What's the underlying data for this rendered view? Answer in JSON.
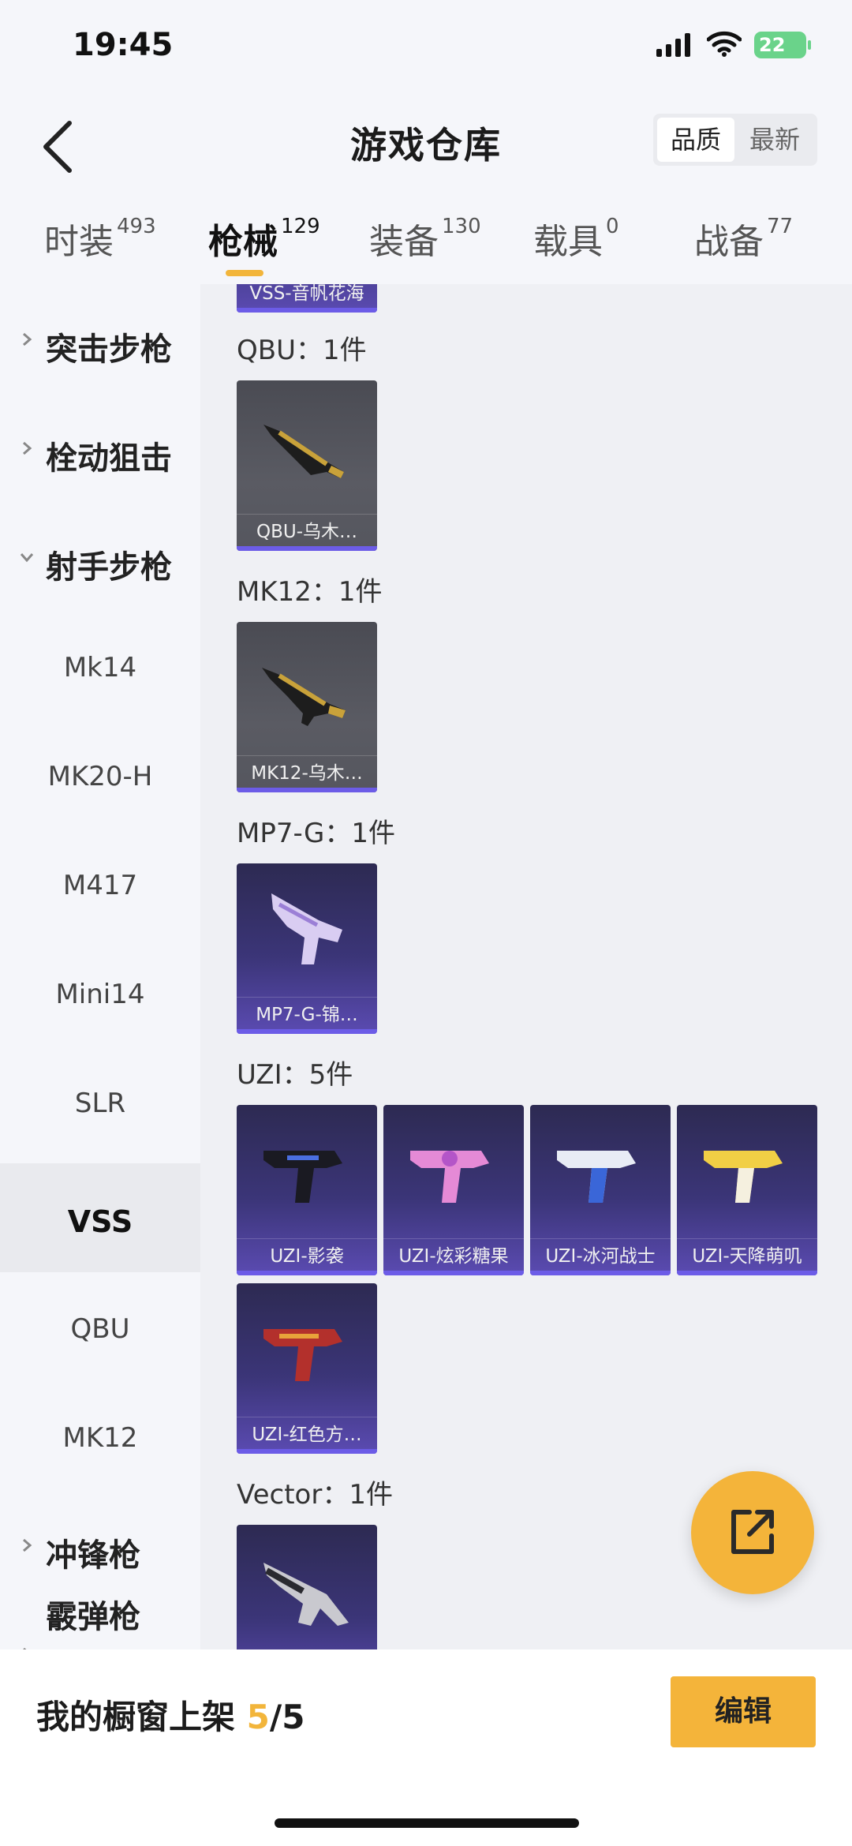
{
  "status": {
    "time": "19:45",
    "battery": "22"
  },
  "header": {
    "title": "游戏仓库",
    "sort": [
      "品质",
      "最新"
    ],
    "tabs": [
      {
        "label": "时装",
        "count": "493"
      },
      {
        "label": "枪械",
        "count": "129"
      },
      {
        "label": "装备",
        "count": "130"
      },
      {
        "label": "载具",
        "count": "0"
      },
      {
        "label": "战备",
        "count": "77"
      }
    ]
  },
  "sidebar": {
    "categories": [
      "突击步枪",
      "栓动狙击",
      "射手步枪",
      "冲锋枪"
    ],
    "sub_items": [
      "Mk14",
      "MK20-H",
      "M417",
      "Mini14",
      "SLR",
      "VSS",
      "QBU",
      "MK12"
    ],
    "partial_category": "霰弹枪"
  },
  "content": {
    "top_partial_card": "VSS-音帆花海",
    "groups": [
      {
        "title": "QBU：1件",
        "items": [
          "QBU-乌木…"
        ]
      },
      {
        "title": "MK12：1件",
        "items": [
          "MK12-乌木…"
        ]
      },
      {
        "title": "MP7-G：1件",
        "items": [
          "MP7-G-锦…"
        ]
      },
      {
        "title": "UZI：5件",
        "items": [
          "UZI-影袭",
          "UZI-炫彩糖果",
          "UZI-冰河战士",
          "UZI-天降萌叽",
          "UZI-红色方…"
        ]
      },
      {
        "title": "Vector：1件",
        "items": [
          ""
        ]
      }
    ]
  },
  "bottom": {
    "label": "我的橱窗上架",
    "shown": "5",
    "total": "/5",
    "edit": "编辑"
  },
  "colors": {
    "accent": "#f4b43a",
    "card_purple": "#3b3578",
    "card_dark": "#55565e"
  }
}
